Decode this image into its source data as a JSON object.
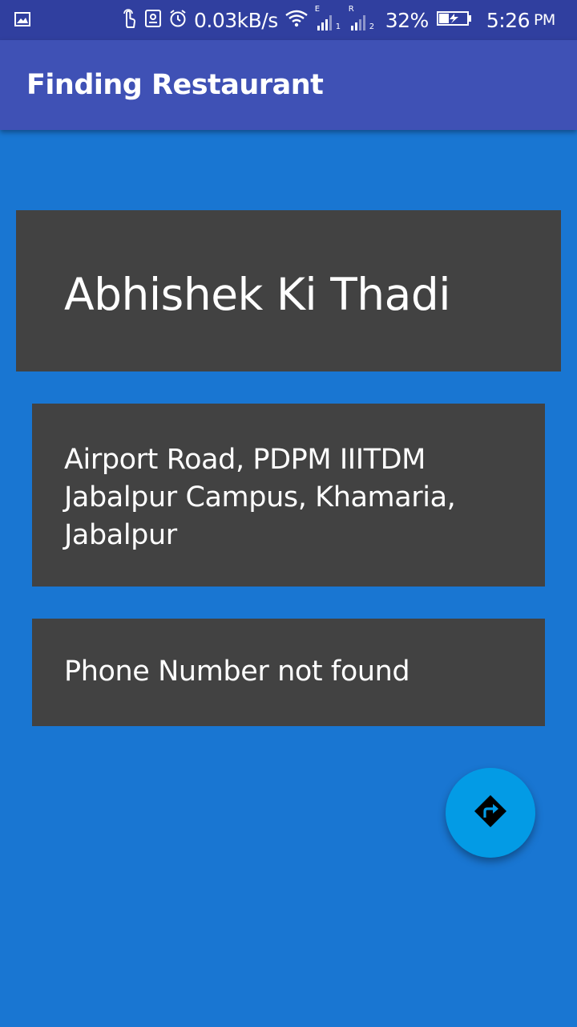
{
  "status_bar": {
    "net_speed": "0.03kB/s",
    "battery_pct": "32%",
    "time": "5:26",
    "ampm": "PM",
    "sim1_tag": "E",
    "sim1_index": "1",
    "sim2_tag": "R",
    "sim2_index": "2",
    "icons": [
      "gallery-icon",
      "touch-icon",
      "screenshot-icon",
      "alarm-icon",
      "wifi-icon",
      "signal-sim1-icon",
      "signal-sim2-icon",
      "battery-icon"
    ]
  },
  "app_bar": {
    "title": "Finding Restaurant"
  },
  "restaurant": {
    "name": "Abhishek Ki Thadi",
    "address": "Airport Road, PDPM IIITDM Jabalpur Campus, Khamaria, Jabalpur",
    "phone": "Phone Number not found"
  },
  "fab": {
    "icon": "directions-icon"
  },
  "colors": {
    "status_bar": "#303f9f",
    "app_bar": "#3f51b5",
    "background": "#1976d2",
    "card": "#424242",
    "fab": "#039be5"
  }
}
